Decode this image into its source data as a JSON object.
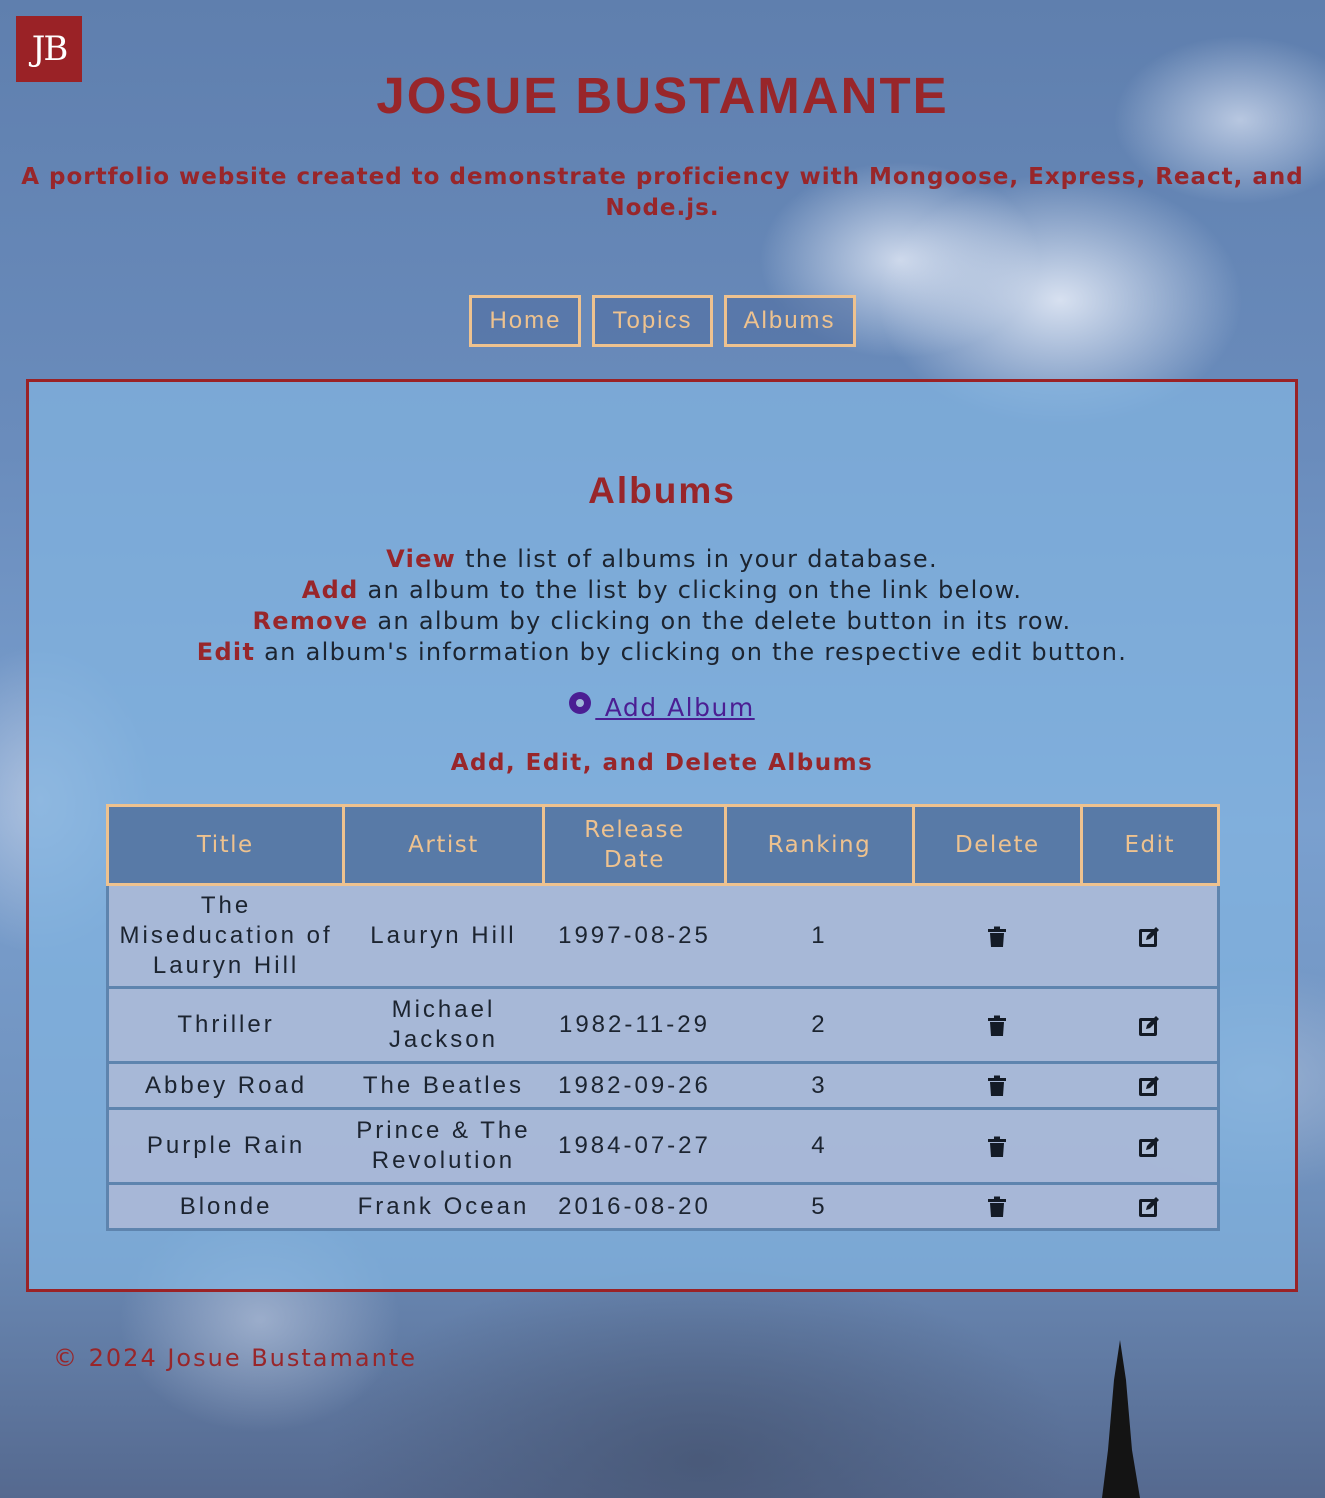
{
  "header": {
    "logo_text": "JB",
    "title": "JOSUE BUSTAMANTE",
    "subtitle": "A portfolio website created to demonstrate proficiency with Mongoose, Express, React, and Node.js."
  },
  "nav": {
    "items": [
      {
        "label": "Home"
      },
      {
        "label": "Topics"
      },
      {
        "label": "Albums"
      }
    ]
  },
  "main": {
    "heading": "Albums",
    "instructions": [
      {
        "keyword": "View",
        "text": " the list of albums in your database."
      },
      {
        "keyword": "Add",
        "text": " an album to the list by clicking on the link below."
      },
      {
        "keyword": "Remove",
        "text": " an album by clicking on the delete button in its row."
      },
      {
        "keyword": "Edit",
        "text": " an album's information by clicking on the respective edit button."
      }
    ],
    "add_link_label": " Add Album",
    "add_link_icon": "disc-icon",
    "table_caption": "Add, Edit, and Delete Albums",
    "table": {
      "headers": [
        "Title",
        "Artist",
        "Release Date",
        "Ranking",
        "Delete",
        "Edit"
      ],
      "rows": [
        {
          "title": "The Miseducation of Lauryn Hill",
          "artist": "Lauryn Hill",
          "release_date": "1997-08-25",
          "ranking": "1"
        },
        {
          "title": "Thriller",
          "artist": "Michael Jackson",
          "release_date": "1982-11-29",
          "ranking": "2"
        },
        {
          "title": "Abbey Road",
          "artist": "The Beatles",
          "release_date": "1982-09-26",
          "ranking": "3"
        },
        {
          "title": "Purple Rain",
          "artist": "Prince & The Revolution",
          "release_date": "1984-07-27",
          "ranking": "4"
        },
        {
          "title": "Blonde",
          "artist": "Frank Ocean",
          "release_date": "2016-08-20",
          "ranking": "5"
        }
      ],
      "delete_icon": "trash-icon",
      "edit_icon": "edit-icon"
    }
  },
  "footer": {
    "copyright": "© 2024 Josue Bustamante"
  },
  "colors": {
    "brand_red": "#98262a",
    "nav_accent": "#eec28f",
    "link_purple": "#4b1e93"
  }
}
